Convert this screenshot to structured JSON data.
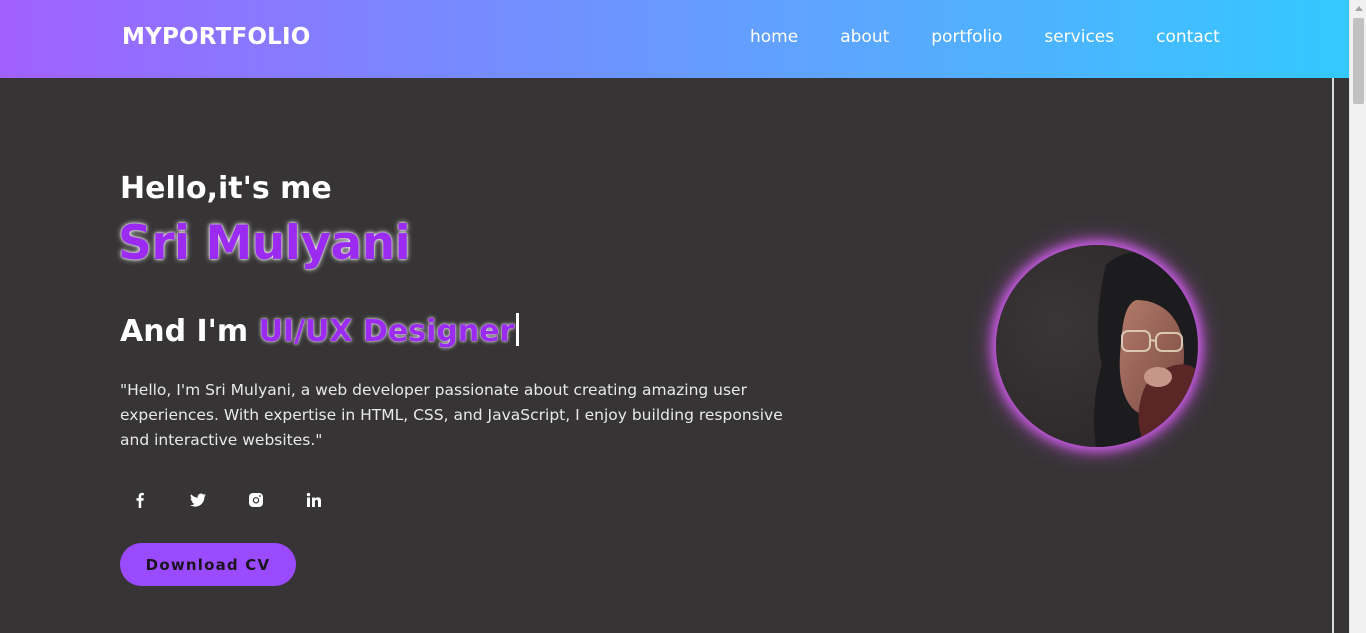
{
  "header": {
    "logo": "MYPORTFOLIO",
    "nav": [
      "home",
      "about",
      "portfolio",
      "services",
      "contact"
    ]
  },
  "hero": {
    "greeting": "Hello,it's me",
    "name": "Sri Mulyani",
    "role_prefix": "And I'm",
    "role": "UI/UX Designer",
    "description": "\"Hello, I'm Sri Mulyani, a web developer passionate about creating amazing user experiences. With expertise in HTML, CSS, and JavaScript, I enjoy building responsive and interactive websites.\"",
    "cv_button": "Download CV"
  },
  "socials": [
    "facebook-icon",
    "twitter-icon",
    "instagram-icon",
    "linkedin-icon"
  ],
  "colors": {
    "accent": "#9b2bf0",
    "button": "#9b4bff",
    "background": "#363435",
    "header_gradient_start": "#a260ff",
    "header_gradient_end": "#33c9ff"
  }
}
